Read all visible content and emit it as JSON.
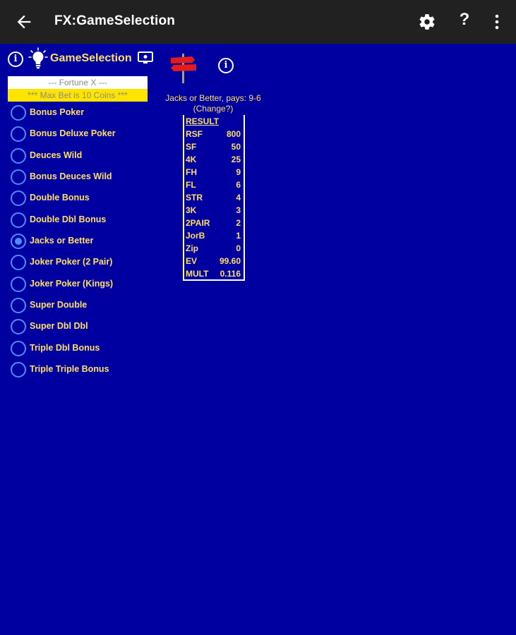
{
  "appbar": {
    "title": "FX:GameSelection",
    "back_icon": "arrow-left-icon",
    "settings_icon": "gear-icon",
    "help_label": "?",
    "more_icon": "more-vert-icon"
  },
  "header": {
    "info_label": "i",
    "game_selection_label": "GameSelection",
    "paytable_info_label": "i"
  },
  "banner": {
    "fortune": "--- Fortune X ---",
    "max_bet": "*** Max Bet is 10 Coins ***"
  },
  "games": [
    {
      "label": "Bonus Poker",
      "selected": false
    },
    {
      "label": "Bonus Deluxe Poker",
      "selected": false
    },
    {
      "label": "Deuces Wild",
      "selected": false
    },
    {
      "label": "Bonus Deuces Wild",
      "selected": false
    },
    {
      "label": "Double Bonus",
      "selected": false
    },
    {
      "label": "Double Dbl Bonus",
      "selected": false
    },
    {
      "label": "Jacks or Better",
      "selected": true
    },
    {
      "label": "Joker Poker (2 Pair)",
      "selected": false
    },
    {
      "label": "Joker Poker (Kings)",
      "selected": false
    },
    {
      "label": "Super Double",
      "selected": false
    },
    {
      "label": "Super Dbl Dbl",
      "selected": false
    },
    {
      "label": "Triple Dbl Bonus",
      "selected": false
    },
    {
      "label": "Triple Triple Bonus",
      "selected": false
    }
  ],
  "paytable": {
    "title": "Jacks or Better, pays: 9-6",
    "change": "(Change?)",
    "header": "RESULT",
    "rows": [
      {
        "hand": "RSF",
        "pay": "800"
      },
      {
        "hand": "SF",
        "pay": "50"
      },
      {
        "hand": "4K",
        "pay": "25"
      },
      {
        "hand": "FH",
        "pay": "9"
      },
      {
        "hand": "FL",
        "pay": "6"
      },
      {
        "hand": "STR",
        "pay": "4"
      },
      {
        "hand": "3K",
        "pay": "3"
      },
      {
        "hand": "2PAIR",
        "pay": "2"
      },
      {
        "hand": "JorB",
        "pay": "1"
      },
      {
        "hand": "Zip",
        "pay": "0"
      },
      {
        "hand": "EV",
        "pay": "99.60"
      },
      {
        "hand": "MULT",
        "pay": "0.116"
      }
    ]
  },
  "colors": {
    "background": "#0000a0",
    "appbar": "#212121",
    "text_yellow": "#ffe066",
    "radio_blue": "#4d8dff",
    "banner_yellow": "#ffe400"
  }
}
